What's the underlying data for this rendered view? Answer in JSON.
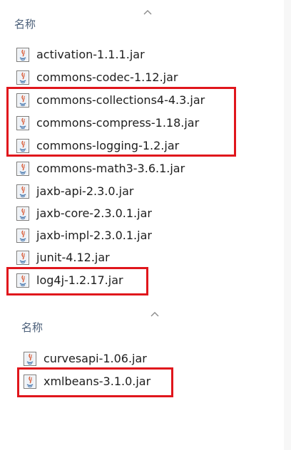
{
  "sections": [
    {
      "header": "名称",
      "items": [
        "activation-1.1.1.jar",
        "commons-codec-1.12.jar",
        "commons-collections4-4.3.jar",
        "commons-compress-1.18.jar",
        "commons-logging-1.2.jar",
        "commons-math3-3.6.1.jar",
        "jaxb-api-2.3.0.jar",
        "jaxb-core-2.3.0.1.jar",
        "jaxb-impl-2.3.0.1.jar",
        "junit-4.12.jar",
        "log4j-1.2.17.jar"
      ]
    },
    {
      "header": "名称",
      "items": [
        "curvesapi-1.06.jar",
        "xmlbeans-3.1.0.jar"
      ]
    }
  ],
  "icons": {
    "file": "java-jar-file-icon",
    "sort": "sort-ascending-chevron-icon"
  },
  "colors": {
    "highlight": "#e0161c",
    "header_text": "#4c607a"
  }
}
